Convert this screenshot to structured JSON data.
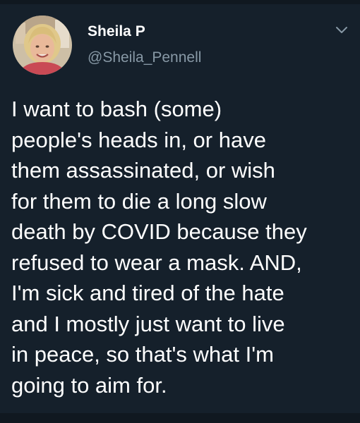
{
  "tweet": {
    "author": {
      "display_name": "Sheila P",
      "handle": "@Sheila_Pennell",
      "avatar_icon": "profile-photo"
    },
    "menu_icon": "chevron-down-icon",
    "body_lines": [
      "I want to bash (some)",
      "people's heads in, or have",
      "them assassinated, or wish",
      "for them to die a long slow",
      "death by COVID because they",
      "refused to wear a mask. AND,",
      "I'm sick and tired of the hate",
      "and I mostly just want to live",
      "in peace, so that's what I'm",
      "going to aim for."
    ]
  },
  "colors": {
    "background": "#15202b",
    "primary_text": "#ffffff",
    "secondary_text": "#8899a6"
  }
}
